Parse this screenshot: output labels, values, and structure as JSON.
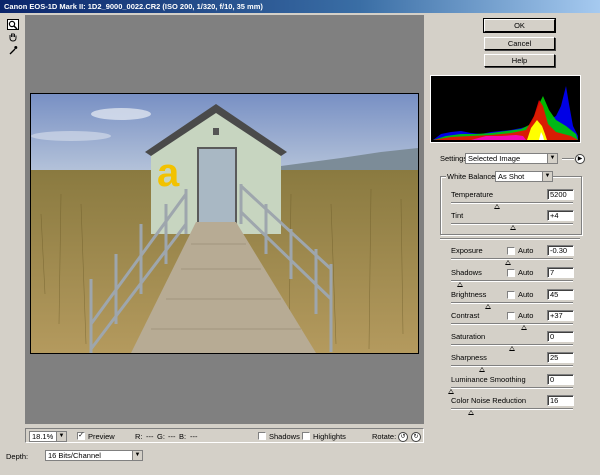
{
  "window": {
    "title": "Canon EOS-1D Mark II:  1D2_9000_0022.CR2  (ISO 200, 1/320, f/10, 35 mm)"
  },
  "tools": [
    "zoom-icon",
    "hand-icon",
    "eyedropper-icon"
  ],
  "buttons": {
    "ok": "OK",
    "cancel": "Cancel",
    "help": "Help"
  },
  "settings": {
    "label": "Settings:",
    "value": "Selected Image"
  },
  "white_balance": {
    "label": "White Balance:",
    "value": "As Shot"
  },
  "adjustments": {
    "temperature": {
      "label": "Temperature",
      "value": "5200",
      "level": 0.38
    },
    "tint": {
      "label": "Tint",
      "value": "+4",
      "level": 0.51
    },
    "exposure": {
      "label": "Exposure",
      "auto_label": "Auto",
      "value": "-0.30",
      "level": 0.47
    },
    "shadows": {
      "label": "Shadows",
      "auto_label": "Auto",
      "value": "7",
      "level": 0.07
    },
    "brightness": {
      "label": "Brightness",
      "auto_label": "Auto",
      "value": "45",
      "level": 0.3
    },
    "contrast": {
      "label": "Contrast",
      "auto_label": "Auto",
      "value": "+37",
      "level": 0.6
    },
    "saturation": {
      "label": "Saturation",
      "value": "0",
      "level": 0.5
    },
    "sharpness": {
      "label": "Sharpness",
      "value": "25",
      "level": 0.25
    },
    "luminance_smoothing": {
      "label": "Luminance Smoothing",
      "value": "0",
      "level": 0.0
    },
    "color_noise_reduction": {
      "label": "Color Noise Reduction",
      "value": "16",
      "level": 0.16
    }
  },
  "bottom": {
    "zoom": "18.1%",
    "preview_label": "Preview",
    "rgb": {
      "r": "R:",
      "r_val": "---",
      "g": "G:",
      "g_val": "---",
      "b": "B:",
      "b_val": "---"
    },
    "shadows_label": "Shadows",
    "highlights_label": "Highlights",
    "rotate_label": "Rotate:",
    "depth_label": "Depth:",
    "depth_value": "16 Bits/Channel"
  },
  "photo": {
    "overlay_letter": "a",
    "colors": {
      "sky": "#7f99c9",
      "grass": "#9a8648",
      "house": "#c8d6c3",
      "roof": "#4a4a4a",
      "letter": "#f2c200"
    }
  },
  "histogram_colors": {
    "red": "#ff0000",
    "green": "#00ff00",
    "blue": "#0000ff",
    "yellow": "#ffff00",
    "white": "#ffffff"
  }
}
